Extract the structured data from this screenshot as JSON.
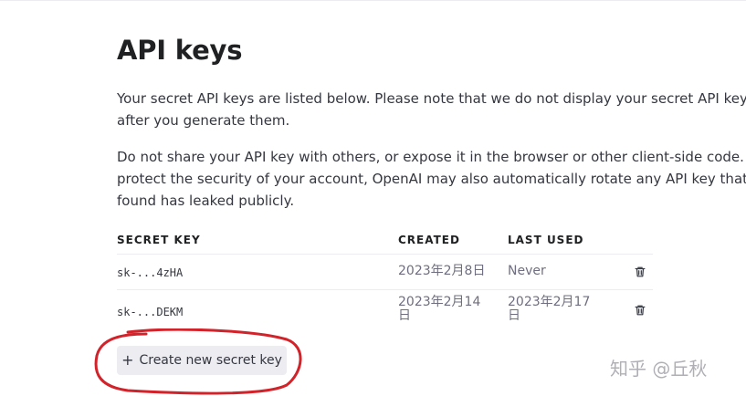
{
  "page": {
    "title": "API keys",
    "paragraph_1": [
      "Your secret API keys are listed below. Please note that we do not display your secret API keys",
      "after you generate them."
    ],
    "paragraph_2": [
      "Do not share your API key with others, or expose it in the browser or other client-side code. In",
      "protect the security of your account, OpenAI may also automatically rotate any API key that w",
      "found has leaked publicly."
    ]
  },
  "table": {
    "headers": {
      "secret_key": "SECRET KEY",
      "created": "CREATED",
      "last_used": "LAST USED"
    },
    "rows": [
      {
        "key": "sk-...4zHA",
        "created": "2023年2月8日",
        "last_used": "Never"
      },
      {
        "key": "sk-...DEKM",
        "created": "2023年2月14日",
        "last_used": "2023年2月17日"
      }
    ]
  },
  "actions": {
    "create_label": "Create new secret key",
    "create_icon": "plus-icon",
    "delete_icon": "trash-icon"
  },
  "overlay": {
    "watermark": "知乎 @丘秋",
    "annotation_color": "#d2232a"
  }
}
